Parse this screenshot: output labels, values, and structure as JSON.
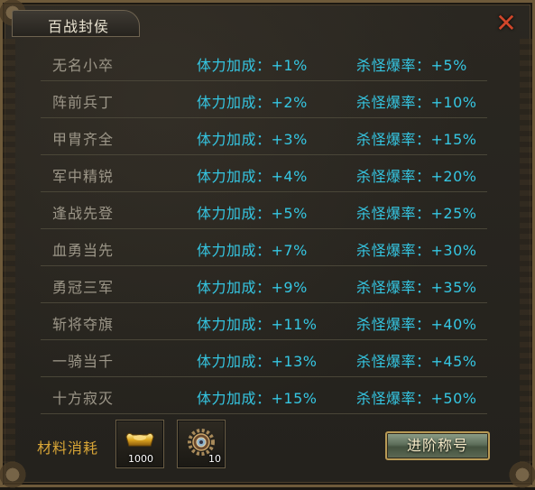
{
  "window": {
    "title": "百战封侯"
  },
  "rows": [
    {
      "name": "无名小卒",
      "attr": "体力加成：+1%",
      "drop": "杀怪爆率：+5%"
    },
    {
      "name": "阵前兵丁",
      "attr": "体力加成：+2%",
      "drop": "杀怪爆率：+10%"
    },
    {
      "name": "甲胄齐全",
      "attr": "体力加成：+3%",
      "drop": "杀怪爆率：+15%"
    },
    {
      "name": "军中精锐",
      "attr": "体力加成：+4%",
      "drop": "杀怪爆率：+20%"
    },
    {
      "name": "逢战先登",
      "attr": "体力加成：+5%",
      "drop": "杀怪爆率：+25%"
    },
    {
      "name": "血勇当先",
      "attr": "体力加成：+7%",
      "drop": "杀怪爆率：+30%"
    },
    {
      "name": "勇冠三军",
      "attr": "体力加成：+9%",
      "drop": "杀怪爆率：+35%"
    },
    {
      "name": "斩将夺旗",
      "attr": "体力加成：+11%",
      "drop": "杀怪爆率：+40%"
    },
    {
      "name": "一骑当千",
      "attr": "体力加成：+13%",
      "drop": "杀怪爆率：+45%"
    },
    {
      "name": "十方寂灭",
      "attr": "体力加成：+15%",
      "drop": "杀怪爆率：+50%"
    }
  ],
  "cost": {
    "label": "材料消耗",
    "items": [
      {
        "icon": "gold-ingot-icon",
        "count": "1000"
      },
      {
        "icon": "gear-medal-icon",
        "count": "10"
      }
    ]
  },
  "actions": {
    "advance_label": "进阶称号"
  },
  "colors": {
    "accent": "#35c6e2",
    "title_name": "#9c9688",
    "gold": "#d9a637",
    "close": "#d0462a"
  }
}
